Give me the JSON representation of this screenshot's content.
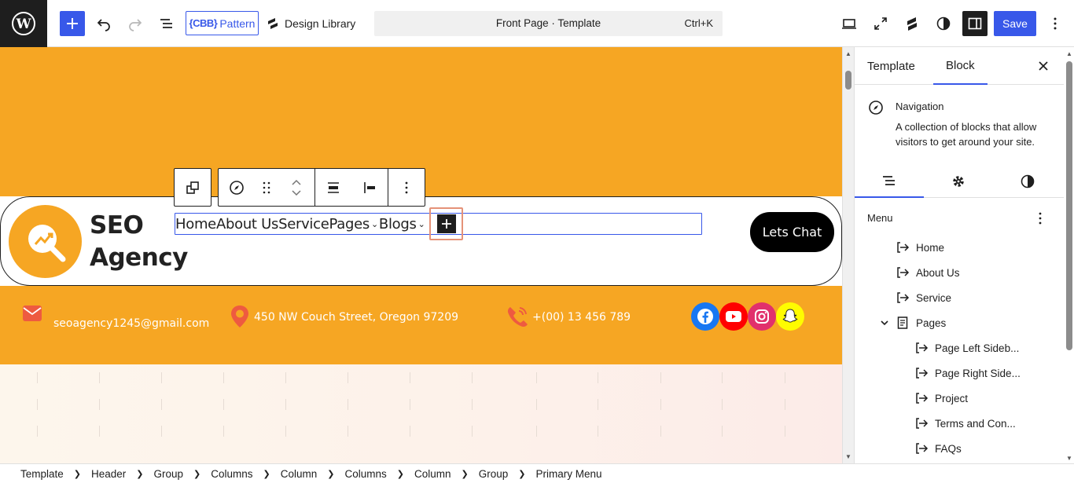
{
  "colors": {
    "accent": "#3858e9",
    "canvas_orange": "#f6a623",
    "highlight": "#e59278"
  },
  "toolbar": {
    "cbb_mark": "{CBB}",
    "cbb_label": "Pattern",
    "design_library": "Design Library",
    "document_title": "Front Page · Template",
    "shortcut": "Ctrl+K",
    "save": "Save"
  },
  "canvas": {
    "logo_line1": "SEO",
    "logo_line2": "Agency",
    "nav": [
      "Home",
      "About Us",
      "Service",
      "Pages",
      "Blogs"
    ],
    "cta": "Lets Chat",
    "email": "seoagency1245@gmail.com",
    "address": "450 NW Couch Street, Oregon 97209",
    "phone": "+(00) 13 456 789",
    "social_icons": [
      "facebook-icon",
      "youtube-icon",
      "instagram-icon",
      "snapchat-icon"
    ]
  },
  "sidebar": {
    "tabs": [
      "Template",
      "Block"
    ],
    "active_tab": "Block",
    "block_name": "Navigation",
    "block_desc": "A collection of blocks that allow visitors to get around your site.",
    "menu_label": "Menu",
    "menu_items": [
      {
        "label": "Home",
        "level": 1
      },
      {
        "label": "About Us",
        "level": 1
      },
      {
        "label": "Service",
        "level": 1
      },
      {
        "label": "Pages",
        "level": 1,
        "expanded": true
      },
      {
        "label": "Page Left Sideb...",
        "level": 2
      },
      {
        "label": "Page Right Side...",
        "level": 2
      },
      {
        "label": "Project",
        "level": 2
      },
      {
        "label": "Terms and Con...",
        "level": 2
      },
      {
        "label": "FAQs",
        "level": 2
      }
    ]
  },
  "breadcrumb": [
    "Template",
    "Header",
    "Group",
    "Columns",
    "Column",
    "Columns",
    "Column",
    "Group",
    "Primary Menu"
  ]
}
